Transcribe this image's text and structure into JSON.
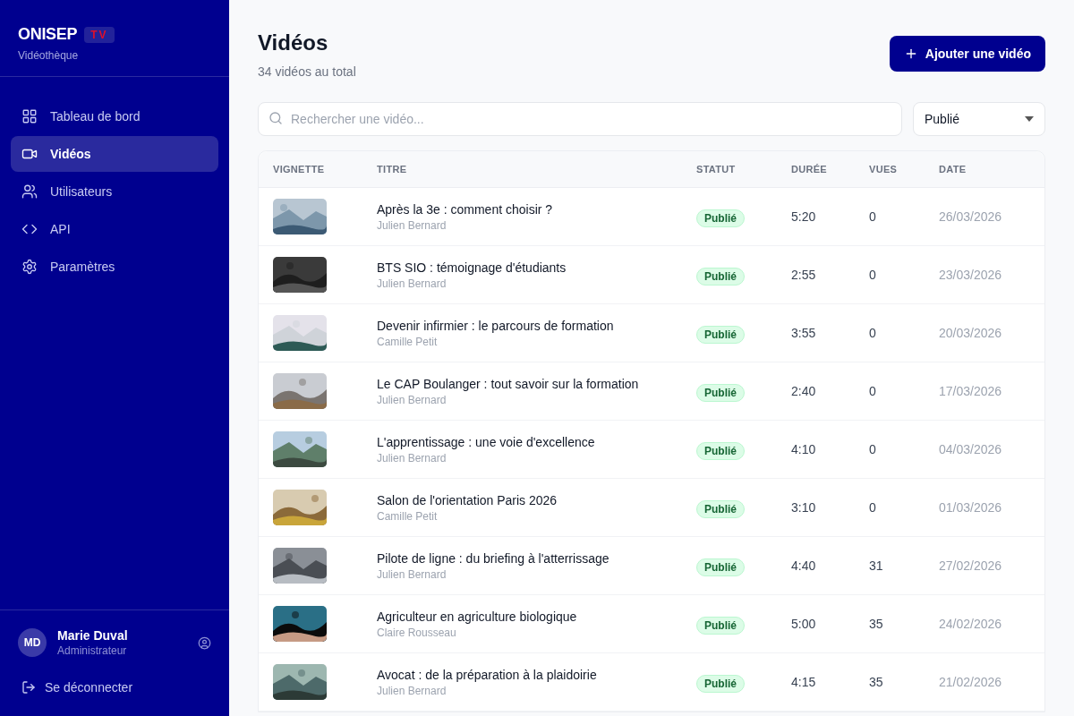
{
  "brand": {
    "name": "ONISEP",
    "badge": "TV",
    "subtitle": "Vidéothèque"
  },
  "nav": [
    {
      "label": "Tableau de bord",
      "kind": "grid",
      "selected": false
    },
    {
      "label": "Vidéos",
      "kind": "video",
      "selected": true
    },
    {
      "label": "Utilisateurs",
      "kind": "users",
      "selected": false
    },
    {
      "label": "API",
      "kind": "code",
      "selected": false
    },
    {
      "label": "Paramètres",
      "kind": "settings",
      "selected": false
    }
  ],
  "user": {
    "initials": "MD",
    "name": "Marie Duval",
    "role": "Administrateur"
  },
  "logout": "Se déconnecter",
  "page": {
    "title": "Vidéos",
    "subtitle": "34 vidéos au total",
    "add_button": "Ajouter une vidéo"
  },
  "search": {
    "placeholder": "Rechercher une vidéo..."
  },
  "status_filter": {
    "value": "Publié"
  },
  "table": {
    "columns": [
      "VIGNETTE",
      "TITRE",
      "STATUT",
      "DURÉE",
      "VUES",
      "DATE"
    ],
    "rows": [
      {
        "title": "Après la 3e : comment choisir ?",
        "author": "Julien Bernard",
        "status": "Publié",
        "duration": "5:20",
        "views": "0",
        "date": "26/03/2026"
      },
      {
        "title": "BTS SIO : témoignage d'étudiants",
        "author": "Julien Bernard",
        "status": "Publié",
        "duration": "2:55",
        "views": "0",
        "date": "23/03/2026"
      },
      {
        "title": "Devenir infirmier : le parcours de formation",
        "author": "Camille Petit",
        "status": "Publié",
        "duration": "3:55",
        "views": "0",
        "date": "20/03/2026"
      },
      {
        "title": "Le CAP Boulanger : tout savoir sur la formation",
        "author": "Julien Bernard",
        "status": "Publié",
        "duration": "2:40",
        "views": "0",
        "date": "17/03/2026"
      },
      {
        "title": "L'apprentissage : une voie d'excellence",
        "author": "Julien Bernard",
        "status": "Publié",
        "duration": "4:10",
        "views": "0",
        "date": "04/03/2026"
      },
      {
        "title": "Salon de l'orientation Paris 2026",
        "author": "Camille Petit",
        "status": "Publié",
        "duration": "3:10",
        "views": "0",
        "date": "01/03/2026"
      },
      {
        "title": "Pilote de ligne : du briefing à l'atterrissage",
        "author": "Julien Bernard",
        "status": "Publié",
        "duration": "4:40",
        "views": "31",
        "date": "27/02/2026"
      },
      {
        "title": "Agriculteur en agriculture biologique",
        "author": "Claire Rousseau",
        "status": "Publié",
        "duration": "5:00",
        "views": "35",
        "date": "24/02/2026"
      },
      {
        "title": "Avocat : de la préparation à la plaidoirie",
        "author": "Julien Bernard",
        "status": "Publié",
        "duration": "4:15",
        "views": "35",
        "date": "21/02/2026"
      }
    ]
  }
}
